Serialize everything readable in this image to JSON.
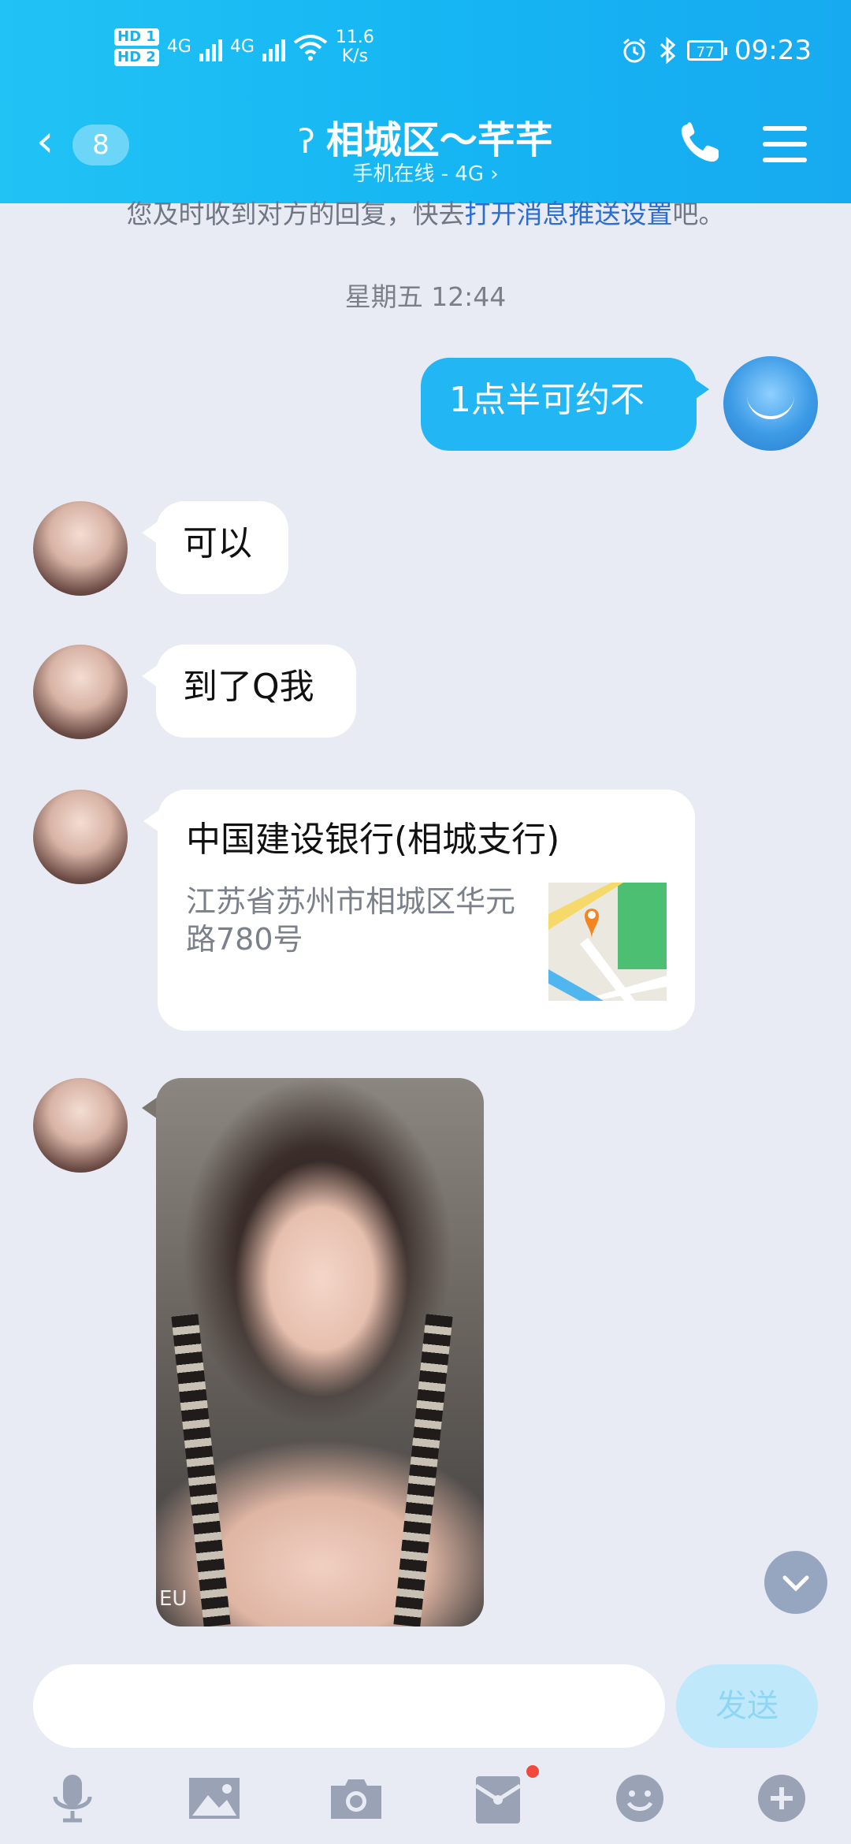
{
  "status_bar": {
    "hd1": "HD 1",
    "hd2": "HD 2",
    "net1": "4G",
    "net2": "4G",
    "speed_value": "11.6",
    "speed_unit": "K/s",
    "battery": "77",
    "time": "09:23"
  },
  "header": {
    "unread_count": "8",
    "contact_name": "相城区～芊芊",
    "status": "手机在线 - 4G ›",
    "accent_color": "#19b4f2"
  },
  "notice": {
    "text_prefix": "您及时收到对方的回复，快去",
    "link_text": "打开消息推送设置",
    "text_suffix": "吧。"
  },
  "messages": {
    "timestamp": "星期五 12:44",
    "outgoing_1": "1点半可约不",
    "incoming_1": "可以",
    "incoming_2": "到了Q我",
    "location": {
      "name": "中国建设银行(相城支行)",
      "address": "江苏省苏州市相城区华元路780号"
    },
    "photo_watermark": "EU"
  },
  "composer": {
    "input_value": "",
    "send_label": "发送"
  },
  "toolbar": {
    "icons": [
      "microphone-icon",
      "image-icon",
      "camera-icon",
      "red-packet-icon",
      "emoji-icon",
      "plus-icon"
    ]
  }
}
